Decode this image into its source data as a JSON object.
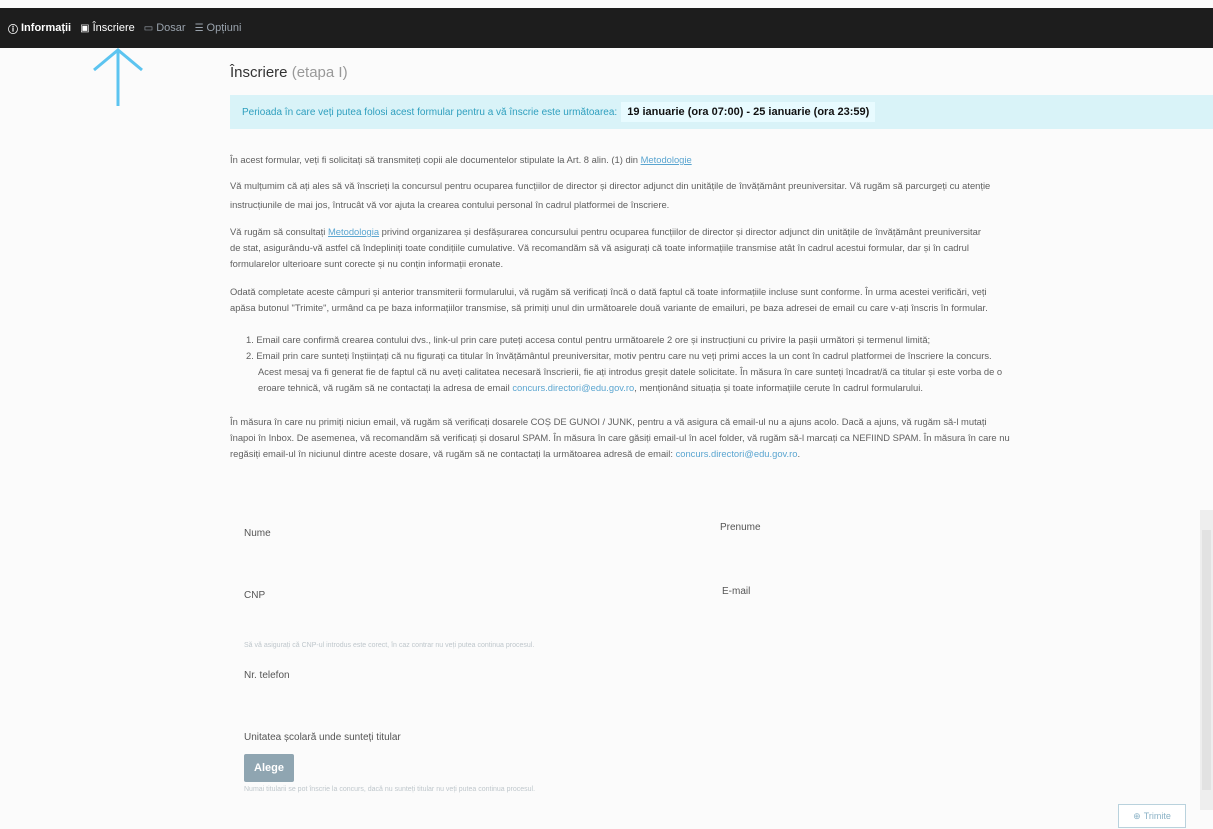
{
  "nav": {
    "items": [
      {
        "icon": "info-circle-icon",
        "label": "Informații"
      },
      {
        "icon": "document-icon",
        "label": "Înscriere"
      },
      {
        "icon": "folder-icon",
        "label": "Dosar"
      },
      {
        "icon": "sliders-icon",
        "label": "Opțiuni"
      }
    ]
  },
  "page": {
    "title": "Înscriere",
    "stage": "(etapa I)"
  },
  "period": {
    "text": "Perioada în care veți putea folosi acest formular pentru a vă înscrie este următoarea:",
    "dates": "19 ianuarie (ora 07:00) - 25 ianuarie (ora 23:59)"
  },
  "content": {
    "p1_before": "În acest formular, veți fi solicitați să transmiteți copii ale documentelor stipulate la Art. 8 alin. (1) din",
    "p1_link": "Metodologie",
    "p2_line1": "Vă mulțumim că ați ales să vă înscrieți la concursul pentru ocuparea funcțiilor de director și director adjunct din unitățile de învățământ preuniversitar. Vă rugăm să parcurgeți cu atenție",
    "p2_line2": "instrucțiunile de mai jos, întrucât vă vor ajuta la crearea contului personal în cadrul platformei de înscriere.",
    "p3_before": "Vă rugăm să consultați",
    "p3_link": "Metodologia",
    "p3_line1_after": "privind organizarea și desfășurarea concursului pentru ocuparea funcțiilor de director și director adjunct din unitățile de învățământ preuniversitar",
    "p3_line2": "de stat, asigurându-vă astfel că îndepliniți toate condițiile cumulative. Vă recomandăm să vă asigurați că toate informațiile transmise atât în cadrul acestui formular, dar și în cadrul",
    "p3_line3": "formularelor ulterioare sunt corecte și nu conțin informații eronate.",
    "p4_line1": "Odată completate aceste câmpuri și anterior transmiterii formularului, vă rugăm să verificați încă o dată faptul că toate informațiile incluse sunt conforme. În urma acestei verificări, veți",
    "p4_line2": "apăsa butonul \"Trimite\", urmând ca pe baza informațiilor transmise, să primiți unul din următoarele două variante de emailuri, pe baza adresei de email cu care v-ați înscris în formular.",
    "li1": "1. Email care confirmă crearea contului dvs., link-ul prin care puteți accesa contul pentru următoarele 2 ore și instrucțiuni cu privire la pașii următori și termenul limită;",
    "li2_line1": "2. Email prin care sunteți înștiințați că nu figurați ca titular în învățământul preuniversitar, motiv pentru care nu veți primi acces la un cont în cadrul platformei de înscriere la concurs.",
    "li2_line2": "Acest mesaj va fi generat fie de faptul că nu aveți calitatea necesară înscrierii, fie ați introdus greșit datele solicitate. În măsura în care sunteți încadrat/ă ca titular și este vorba de o",
    "li2_line3_before": "eroare tehnică, vă rugăm să ne contactați la adresa de email",
    "li2_email": "concurs.directori@edu.gov.ro",
    "li2_line3_after": ", menționând situația și toate informațiile cerute în cadrul formularului.",
    "p5_line1": "În măsura în care nu primiți niciun email, vă rugăm să verificați dosarele COȘ DE GUNOI / JUNK, pentru a vă asigura că email-ul nu a ajuns acolo. Dacă a ajuns, vă rugăm să-l mutați",
    "p5_line2": "înapoi în Inbox. De asemenea, vă recomandăm să verificați și dosarul SPAM. În măsura în care găsiți email-ul în acel folder, vă rugăm să-l marcați ca NEFIIND SPAM. În măsura în care nu",
    "p5_line3_before": "regăsiți email-ul în niciunul dintre aceste dosare, vă rugăm să ne contactați la următoarea adresă de email:",
    "p5_email": "concurs.directori@edu.gov.ro",
    "p5_end": "."
  },
  "form": {
    "nume_label": "Nume",
    "prenume_label": "Prenume",
    "cnp_label": "CNP",
    "email_label": "E-mail",
    "cnp_help": "Să vă asigurați că CNP-ul introdus este corect, în caz contrar nu veți putea continua procesul.",
    "telefon_label": "Nr. telefon",
    "unitate_label": "Unitatea școlară unde sunteți titular",
    "alege_label": "Alege",
    "unitate_help": "Numai titularii se pot înscrie la concurs, dacă nu sunteți titular nu veți putea continua procesul.",
    "trimite_label": "Trimite"
  }
}
